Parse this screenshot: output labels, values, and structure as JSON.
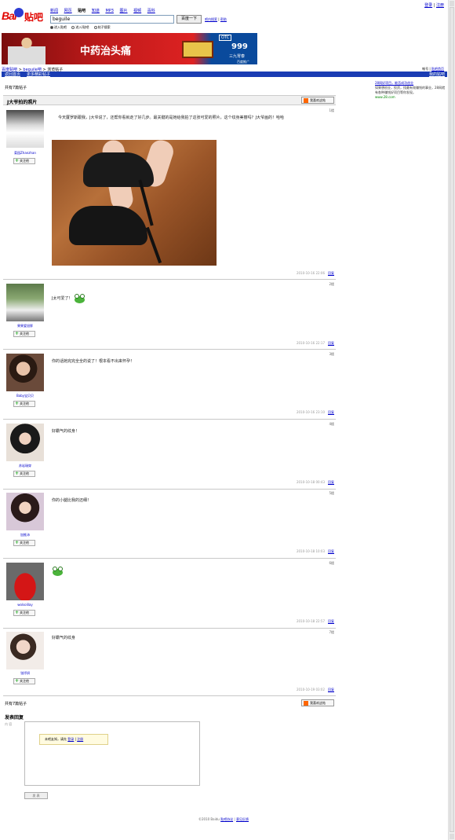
{
  "top_links": {
    "login": "登录",
    "register": "注册"
  },
  "header": {
    "nav": [
      "新闻",
      "网页",
      "贴吧",
      "知道",
      "MP3",
      "图片",
      "视频",
      "百科"
    ],
    "nav_current_index": 2,
    "search_value": "beguile",
    "search_button": "百度一下",
    "search_extra": [
      "吧内搜索",
      "帮助"
    ],
    "radios": [
      "进入贴吧",
      "进入i贴吧",
      "帖子搜索"
    ],
    "radio_selected_index": 0
  },
  "banner": {
    "slogan": "中药治头痛",
    "otc": "OTC",
    "number": "999",
    "brand": "三九胃泰",
    "union": "百度推广"
  },
  "breadcrumb": {
    "items": [
      "百度贴吧",
      "beguile吧"
    ],
    "current": "浏览帖子"
  },
  "crumb_right": {
    "a": "帐号",
    "b": "贴吧首页"
  },
  "bluebar": {
    "left": [
      "返回首页",
      "更多精彩帖子"
    ],
    "right": "我的贴吧"
  },
  "replies_top": "共有7篇帖子",
  "thread": {
    "title": "J大爷拍的照片",
    "fav_button": "我喜欢这帖"
  },
  "posts": [
    {
      "user": "菊园Zhanzhan",
      "follow": "关注他",
      "floor": "1楼",
      "text": "今天厦罗斯跟我，J大爷说了，还帮你看就走了好几步。最关键的是她给我拍了这张可爱的照片，这个纹身美丽吗？J大爷画的！哈哈",
      "time": "2010-10-16 22:06",
      "reply": "回复"
    },
    {
      "user": "果果爱旭胖",
      "follow": "关注他",
      "floor": "2楼",
      "text": "J太可爱了！",
      "time": "2010-10-16 22:17",
      "reply": "回复"
    },
    {
      "user": "Baby宝贝贝",
      "follow": "关注他",
      "floor": "3楼",
      "text": "你的话她完完全全的说了！根本看不出来怀孕！",
      "time": "2010-10-16 23:10",
      "reply": "回复"
    },
    {
      "user": "苏岩瑞穿",
      "follow": "关注他",
      "floor": "4楼",
      "text": "好霸气的纹身！",
      "time": "2010-10-18 00:43",
      "reply": "回复"
    },
    {
      "user": "加推沛",
      "follow": "关注他",
      "floor": "5楼",
      "text": "你的小腿比我的还细！",
      "time": "2010-10-18 10:03",
      "reply": "回复"
    },
    {
      "user": "wolsolilay",
      "follow": "关注他",
      "floor": "6楼",
      "text": "",
      "time": "2010-10-18 22:57",
      "reply": "回复"
    },
    {
      "user": "张抒妍",
      "follow": "关注他",
      "floor": "7楼",
      "text": "好霸气的纹身",
      "time": "2010-10-19 03:02",
      "reply": "回复"
    }
  ],
  "replies_bottom": "共有7篇帖子",
  "reply_box": {
    "title": "发表回复",
    "label": "内 容",
    "tip_prefix": "未吧友知，请先",
    "login": "登录",
    "register": "注册",
    "submit": "发 表"
  },
  "sidebar": {
    "title": "28网好项目，能否成功创业",
    "desc": "如果想创业，投资，找最有效赚钱的事业，28网就有各种赚钱好项目等你发现。",
    "url": "www.28.com"
  },
  "footer": {
    "text": "©2010 Baidu",
    "links": [
      "贴吧协议",
      "意见反馈"
    ]
  }
}
